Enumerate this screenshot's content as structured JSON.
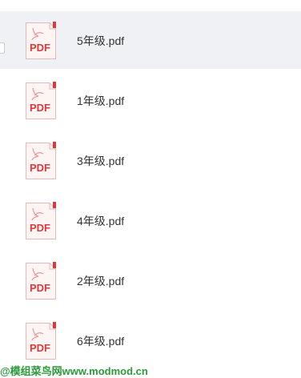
{
  "files": [
    {
      "name": "5年级.pdf",
      "icon": "pdf-file-icon",
      "icon_label": "PDF",
      "selected": true
    },
    {
      "name": "1年级.pdf",
      "icon": "pdf-file-icon",
      "icon_label": "PDF",
      "selected": false
    },
    {
      "name": "3年级.pdf",
      "icon": "pdf-file-icon",
      "icon_label": "PDF",
      "selected": false
    },
    {
      "name": "4年级.pdf",
      "icon": "pdf-file-icon",
      "icon_label": "PDF",
      "selected": false
    },
    {
      "name": "2年级.pdf",
      "icon": "pdf-file-icon",
      "icon_label": "PDF",
      "selected": false
    },
    {
      "name": "6年级.pdf",
      "icon": "pdf-file-icon",
      "icon_label": "PDF",
      "selected": false
    }
  ],
  "watermark": "@模组菜鸟网www.modmod.cn",
  "colors": {
    "selected_row_bg": "#f0f1f4",
    "pdf_red": "#d83b3b",
    "pdf_page_bg": "#fdf4f4",
    "text": "#333333",
    "watermark": "#2a9a3a"
  }
}
